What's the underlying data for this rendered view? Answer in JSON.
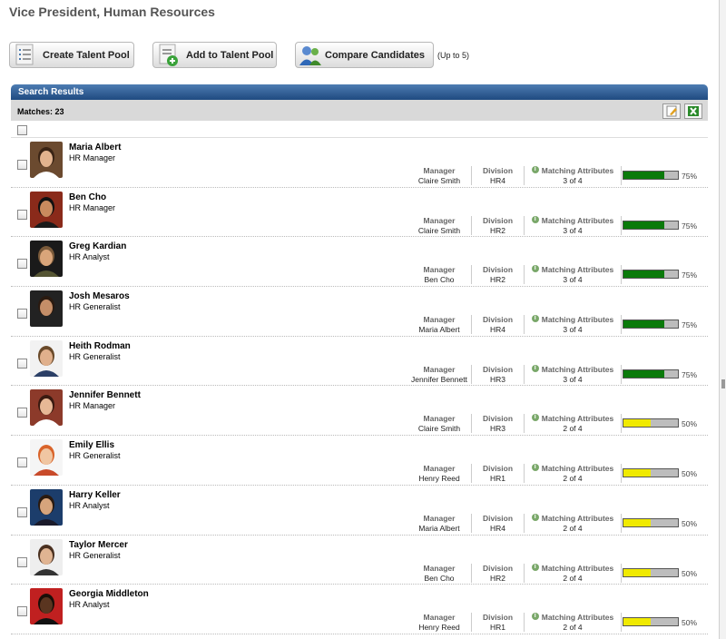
{
  "page": {
    "title": "Vice President, Human Resources"
  },
  "toolbar": {
    "create_label": "Create Talent Pool",
    "add_label": "Add to Talent Pool",
    "compare_label": "Compare Candidates",
    "compare_note": "(Up to 5)"
  },
  "results": {
    "header": "Search Results",
    "matches": "Matches: 23",
    "col_manager": "Manager",
    "col_division": "Division",
    "col_attrs": "Matching Attributes"
  },
  "colors": {
    "high": "#0a7a0a",
    "mid": "#f0ea00",
    "header": "#2a5a93"
  },
  "candidates": [
    {
      "name": "Maria Albert",
      "role": "HR Manager",
      "manager": "Claire Smith",
      "division": "HR4",
      "attrs": "3 of 4",
      "percent": "75%",
      "level": 0.75,
      "avatar": {
        "bg": "#6b4a2f",
        "skin": "#e2b38e",
        "hair": "#3a2415",
        "shirt": "#ffffff"
      }
    },
    {
      "name": "Ben Cho",
      "role": "HR Manager",
      "manager": "Claire Smith",
      "division": "HR2",
      "attrs": "3 of 4",
      "percent": "75%",
      "level": 0.75,
      "avatar": {
        "bg": "#8a2a1a",
        "skin": "#c98a5e",
        "hair": "#111111",
        "shirt": "#1a1a1a"
      }
    },
    {
      "name": "Greg Kardian",
      "role": "HR Analyst",
      "manager": "Ben Cho",
      "division": "HR2",
      "attrs": "3 of 4",
      "percent": "75%",
      "level": 0.75,
      "avatar": {
        "bg": "#1a1a1a",
        "skin": "#d9a57a",
        "hair": "#7a5a3a",
        "shirt": "#555533"
      }
    },
    {
      "name": "Josh Mesaros",
      "role": "HR Generalist",
      "manager": "Maria Albert",
      "division": "HR4",
      "attrs": "3 of 4",
      "percent": "75%",
      "level": 0.75,
      "avatar": {
        "bg": "#222222",
        "skin": "#c48e68",
        "hair": "#2a1a10",
        "shirt": "#222222"
      }
    },
    {
      "name": "Heith Rodman",
      "role": "HR Generalist",
      "manager": "Jennifer Bennett",
      "division": "HR3",
      "attrs": "3 of 4",
      "percent": "75%",
      "level": 0.75,
      "avatar": {
        "bg": "#f2f2f2",
        "skin": "#e0b08c",
        "hair": "#6a4a2a",
        "shirt": "#2b3f66"
      }
    },
    {
      "name": "Jennifer Bennett",
      "role": "HR Manager",
      "manager": "Claire Smith",
      "division": "HR3",
      "attrs": "2 of 4",
      "percent": "50%",
      "level": 0.5,
      "avatar": {
        "bg": "#8c3a2a",
        "skin": "#e7b896",
        "hair": "#3a1a10",
        "shirt": "#ffffff"
      }
    },
    {
      "name": "Emily Ellis",
      "role": "HR Generalist",
      "manager": "Henry Reed",
      "division": "HR1",
      "attrs": "2 of 4",
      "percent": "50%",
      "level": 0.5,
      "avatar": {
        "bg": "#f5f5f5",
        "skin": "#f0c6a2",
        "hair": "#d9642a",
        "shirt": "#c84a2a"
      }
    },
    {
      "name": "Harry Keller",
      "role": "HR Analyst",
      "manager": "Maria Albert",
      "division": "HR4",
      "attrs": "2 of 4",
      "percent": "50%",
      "level": 0.5,
      "avatar": {
        "bg": "#1c3d6b",
        "skin": "#d6a47c",
        "hair": "#2a1a10",
        "shirt": "#1a1a2a"
      }
    },
    {
      "name": "Taylor Mercer",
      "role": "HR Generalist",
      "manager": "Ben Cho",
      "division": "HR2",
      "attrs": "2 of 4",
      "percent": "50%",
      "level": 0.5,
      "avatar": {
        "bg": "#eeeeee",
        "skin": "#e0b492",
        "hair": "#4a3020",
        "shirt": "#333333"
      }
    },
    {
      "name": "Georgia Middleton",
      "role": "HR Analyst",
      "manager": "Henry Reed",
      "division": "HR1",
      "attrs": "2 of 4",
      "percent": "50%",
      "level": 0.5,
      "avatar": {
        "bg": "#c02020",
        "skin": "#5a3520",
        "hair": "#1a0f08",
        "shirt": "#111111"
      }
    }
  ]
}
